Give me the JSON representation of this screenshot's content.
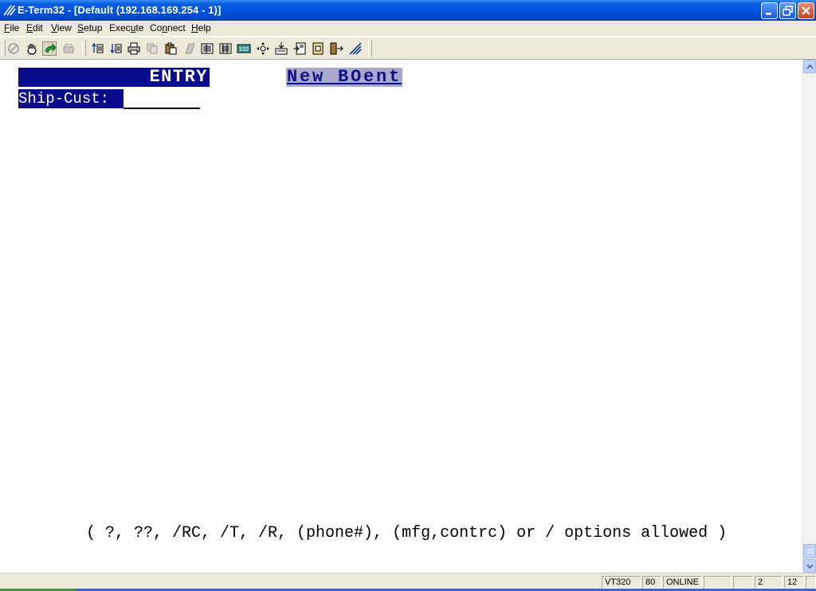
{
  "window": {
    "title": "E-Term32 - [Default (192.168.169.254 - 1)]"
  },
  "menu": {
    "items": [
      {
        "mnemonic": "F",
        "rest": "ile"
      },
      {
        "mnemonic": "E",
        "rest": "dit"
      },
      {
        "mnemonic": "V",
        "rest": "iew"
      },
      {
        "mnemonic": "S",
        "rest": "etup"
      },
      {
        "prefix": "Exec",
        "mnemonic": "u",
        "rest": "te"
      },
      {
        "prefix": "Co",
        "mnemonic": "n",
        "rest": "nect"
      },
      {
        "mnemonic": "H",
        "rest": "elp"
      }
    ]
  },
  "toolbar": {
    "buttons": [
      "stop-icon",
      "hand-icon",
      "connect-icon",
      "disconnect-icon",
      "send-file-icon",
      "receive-file-icon",
      "print-icon",
      "copy-icon",
      "paste-icon",
      "blank-icon",
      "columns-80-icon",
      "columns-100-icon",
      "columns-132-icon",
      "move-icon",
      "capture-icon",
      "macro-icon",
      "notes-icon",
      "exit-icon",
      "setup-icon"
    ]
  },
  "terminal": {
    "entry_title": "ENTRY",
    "program_name": "New BOent",
    "field_label": "Ship-Cust: ",
    "field_value": "",
    "hint": "( ?, ??, /RC, /T, /R, (phone#), (mfg,contrc) or / options allowed )"
  },
  "status": {
    "emulation": "VT320",
    "columns": "80",
    "state": "ONLINE",
    "blank1": "",
    "blank2": "",
    "row": "2",
    "col": "12",
    "blank3": ""
  },
  "colors": {
    "titlebar": "#0054e3",
    "terminal_highlight": "#0a0a8c",
    "terminal_bg": "#ffffff",
    "program_name_bg": "#a8a8c8"
  }
}
